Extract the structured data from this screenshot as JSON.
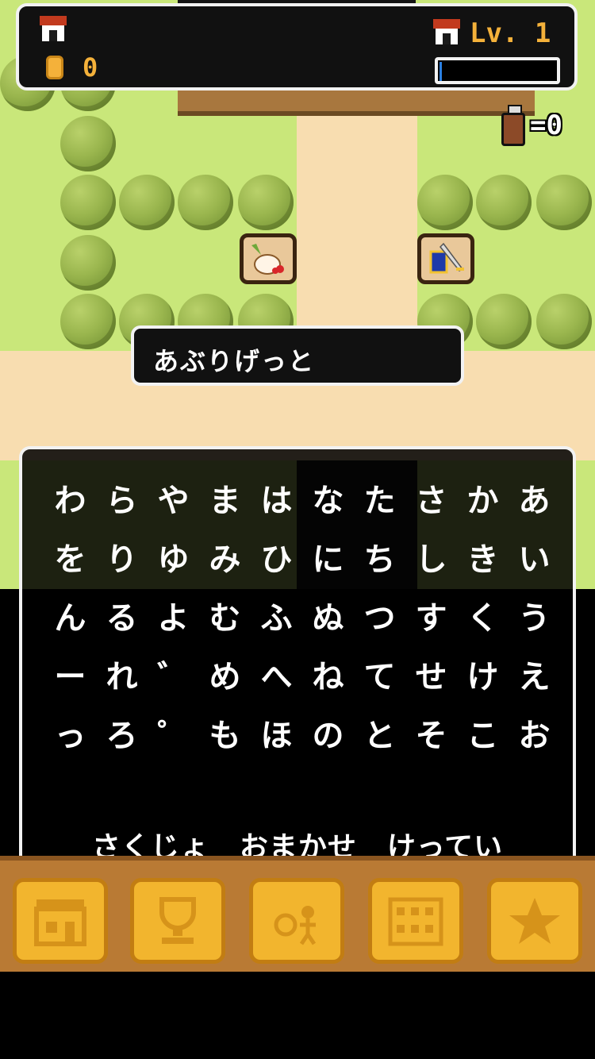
{
  "hud": {
    "coins": "0",
    "level_label": "Lv. 1",
    "xp_progress": 0.02,
    "house_icon": "house-icon",
    "coin_icon": "coin-icon"
  },
  "bottle": {
    "count": "=0",
    "icon": "bottle-icon"
  },
  "shops": [
    {
      "icon": "radish-vegetable-icon"
    },
    {
      "icon": "sword-shield-icon"
    }
  ],
  "name_input": {
    "value": "あぶりげっと"
  },
  "keyboard": {
    "rows": [
      [
        "わ",
        "ら",
        "や",
        "ま",
        "は",
        "な",
        "た",
        "さ",
        "か",
        "あ"
      ],
      [
        "を",
        "り",
        "ゆ",
        "み",
        "ひ",
        "に",
        "ち",
        "し",
        "き",
        "い"
      ],
      [
        "ん",
        "る",
        "よ",
        "む",
        "ふ",
        "ぬ",
        "つ",
        "す",
        "く",
        "う"
      ],
      [
        "ー",
        "れ",
        "゛",
        "め",
        "へ",
        "ね",
        "て",
        "せ",
        "け",
        "え"
      ],
      [
        "っ",
        "ろ",
        "゜",
        "も",
        "ほ",
        "の",
        "と",
        "そ",
        "こ",
        "お"
      ]
    ],
    "actions": {
      "delete": "さくじょ",
      "random": "おまかせ",
      "confirm": "けってい"
    }
  },
  "nav": [
    {
      "icon": "shop-building-icon"
    },
    {
      "icon": "trophy-icon"
    },
    {
      "icon": "characters-icon"
    },
    {
      "icon": "town-buildings-icon"
    },
    {
      "icon": "star-icon"
    }
  ],
  "colors": {
    "grass": "#c9e77a",
    "path": "#f8ddb0",
    "gold": "#f4b13a",
    "nav_bg": "#b97a34",
    "nav_button": "#f2b52e"
  }
}
